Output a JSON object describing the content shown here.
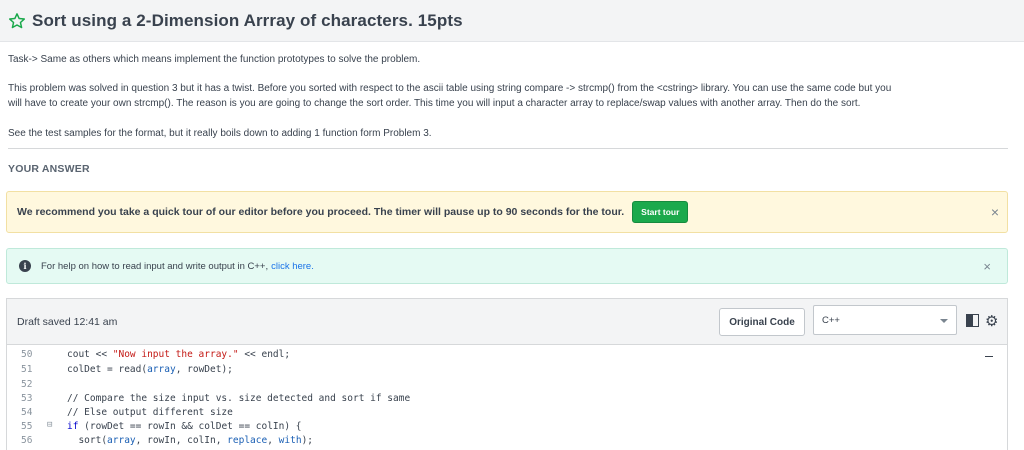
{
  "header": {
    "title": "Sort using a 2-Dimension Arrray of characters. 15pts",
    "star_icon": "star-outline-icon"
  },
  "description": {
    "task": "Task-> Same as others which means implement the function prototypes to solve the problem.",
    "line1": "This problem was solved in question 3 but it has a twist.  Before you sorted with respect to the ascii table using string compare -> strcmp() from the <cstring> library.  You can use the same code but you",
    "line2": "will have to create your own strcmp().  The reason is you are going to change the sort order.  This time you will input a character array to replace/swap values with another array.  Then do the sort.",
    "note": "See the test samples for the format, but it really boils down to adding 1 function form Problem 3."
  },
  "your_answer": "YOUR ANSWER",
  "tour_banner": {
    "text": "We recommend you take a quick tour of our editor before you proceed. The timer will pause up to 90 seconds for the tour.",
    "button": "Start tour",
    "close": "×"
  },
  "help_banner": {
    "info_icon": "i",
    "text": "For help on how to read input and write output in C++,",
    "link": "click here.",
    "close": "×"
  },
  "editor": {
    "draft_status": "Draft saved 12:41 am",
    "original_code_button": "Original Code",
    "language": "C++",
    "gear_glyph": "⚙"
  },
  "code_lines": [
    {
      "num": "50",
      "fold": ""
    },
    {
      "num": "51",
      "fold": ""
    },
    {
      "num": "52",
      "fold": ""
    },
    {
      "num": "53",
      "fold": ""
    },
    {
      "num": "54",
      "fold": ""
    },
    {
      "num": "55",
      "fold": "⊟"
    },
    {
      "num": "56",
      "fold": ""
    }
  ],
  "code_text": {
    "l50_a": "cout << ",
    "l50_str": "\"Now input the array.\"",
    "l50_b": " << endl;",
    "l51_a": "colDet = read(",
    "l51_v1": "array",
    "l51_b": ", rowDet);",
    "l53": "// Compare the size input vs. size detected and sort if same",
    "l54": "// Else output different size",
    "l55_kw": "if",
    "l55_b": " (rowDet == rowIn && colDet == colIn) {",
    "l56_a": "  sort(",
    "l56_v1": "array",
    "l56_b": ", rowIn, colIn, ",
    "l56_v2": "replace",
    "l56_c": ", ",
    "l56_v3": "with",
    "l56_d": ");"
  }
}
